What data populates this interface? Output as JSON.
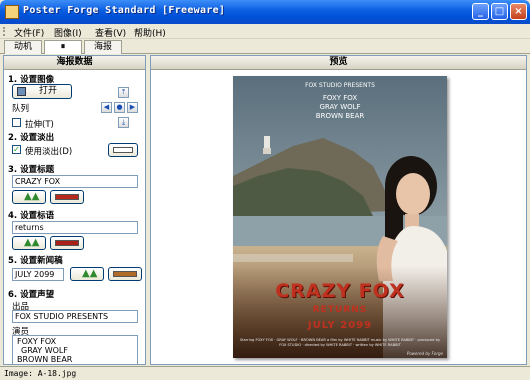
{
  "window": {
    "title": "Poster Forge Standard [Freeware]",
    "minimize_glyph": "_",
    "maximize_glyph": "□",
    "close_glyph": "×"
  },
  "menu": [
    "文件(F)",
    "图像(I)",
    "查看(V)",
    "帮助(H)"
  ],
  "tabs": [
    "动机",
    "⏸",
    "海报"
  ],
  "left_panel": {
    "header": "海报数据",
    "sections": {
      "image": "1. 设置图像",
      "fade": "2. 设置淡出",
      "title": "3. 设置标题",
      "tagline": "4. 设置标语",
      "release": "5. 设置新闻稿",
      "credits": "6. 设置声望"
    },
    "open_button": "打开",
    "queue_label": "队列",
    "stretch_label": "拉伸(T)",
    "use_fade_label": "使用淡出(D)",
    "title_value": "CRAZY FOX",
    "tagline_value": "returns",
    "release_value": "JULY 2099",
    "producer_label": "出品",
    "producer_value": "FOX STUDIO PRESENTS",
    "cast_label": "演员",
    "cast": [
      "FOXY FOX",
      "GRAY WOLF",
      "BROWN BEAR"
    ],
    "title_color": "#b8291e",
    "tagline_color": "#a82018",
    "release_color": "#b06a2a",
    "fade_color": "#ffffff",
    "checked_glyph": "✓"
  },
  "right_panel": {
    "header": "预览"
  },
  "poster": {
    "studio": "FOX STUDIO PRESENTS",
    "actors": [
      "FOXY FOX",
      "GRAY WOLF",
      "BROWN BEAR"
    ],
    "title": "CRAZY FOX",
    "tagline": "RETURNS",
    "release": "JULY 2099",
    "credits": "Starring FOXY FOX · GRAY WOLF · BROWN BEAR a film by WHITE RABBIT music by WHITE RABBIT · produced by FOX STUDIO · directed by WHITE RABBIT · written by WHITE RABBIT",
    "powered": "Powered by Forge"
  },
  "status": {
    "text": "Image: A-18.jpg"
  }
}
